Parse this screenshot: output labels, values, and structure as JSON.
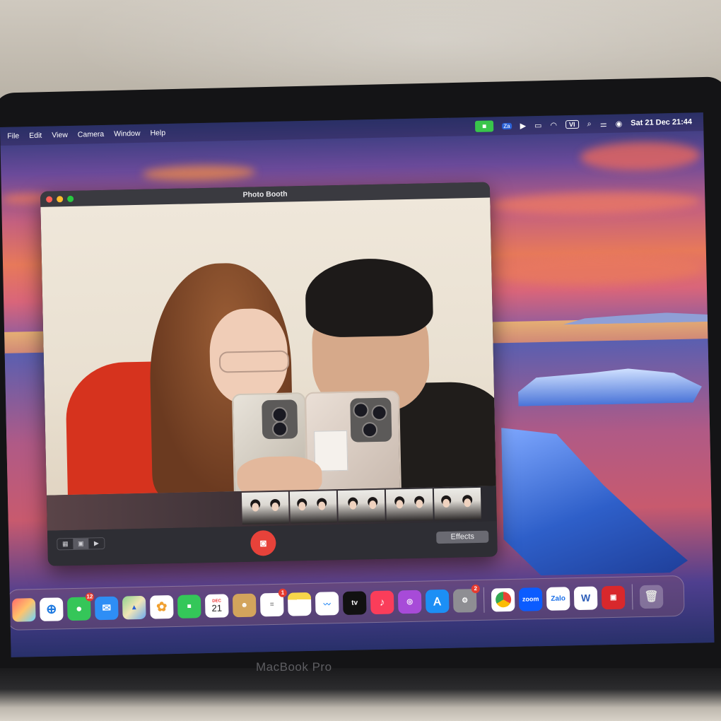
{
  "device": {
    "brand_label": "MacBook Pro"
  },
  "menubar": {
    "items": [
      "File",
      "Edit",
      "View",
      "Camera",
      "Window",
      "Help"
    ],
    "status_icons": [
      "facetime-camera-icon",
      "zalo-status-icon",
      "play-icon",
      "battery-icon",
      "wifi-icon",
      "input-source-icon",
      "search-icon",
      "control-center-icon",
      "siri-icon"
    ],
    "input_source": "VI",
    "datetime": "Sat 21 Dec  21:44"
  },
  "photo_booth": {
    "title": "Photo Booth",
    "view_modes": [
      "grid-view-icon",
      "single-view-icon",
      "video-view-icon"
    ],
    "selected_view": "single-view-icon",
    "effects_label": "Effects",
    "thumbnail_count": 5
  },
  "dock": {
    "apps": [
      {
        "name": "launchpad",
        "label": "",
        "badge": ""
      },
      {
        "name": "safari",
        "label": "",
        "badge": ""
      },
      {
        "name": "messages",
        "label": "",
        "badge": "12"
      },
      {
        "name": "mail",
        "label": "",
        "badge": ""
      },
      {
        "name": "maps",
        "label": "",
        "badge": ""
      },
      {
        "name": "photos",
        "label": "",
        "badge": ""
      },
      {
        "name": "facetime",
        "label": "",
        "badge": ""
      },
      {
        "name": "calendar",
        "label": "21",
        "month": "DEC",
        "badge": ""
      },
      {
        "name": "contacts",
        "label": "",
        "badge": ""
      },
      {
        "name": "reminders",
        "label": "",
        "badge": "1"
      },
      {
        "name": "notes",
        "label": "",
        "badge": ""
      },
      {
        "name": "freeform",
        "label": "",
        "badge": ""
      },
      {
        "name": "apple-tv",
        "label": "tv",
        "badge": ""
      },
      {
        "name": "music",
        "label": "",
        "badge": ""
      },
      {
        "name": "podcasts",
        "label": "",
        "badge": ""
      },
      {
        "name": "app-store",
        "label": "",
        "badge": ""
      },
      {
        "name": "system-settings",
        "label": "",
        "badge": "2"
      },
      {
        "name": "chrome",
        "label": "",
        "badge": ""
      },
      {
        "name": "zoom",
        "label": "zoom",
        "badge": ""
      },
      {
        "name": "zalo",
        "label": "Zalo",
        "badge": ""
      },
      {
        "name": "word",
        "label": "W",
        "badge": ""
      },
      {
        "name": "photo-booth",
        "label": "",
        "badge": ""
      },
      {
        "name": "trash",
        "label": "",
        "badge": ""
      }
    ]
  }
}
